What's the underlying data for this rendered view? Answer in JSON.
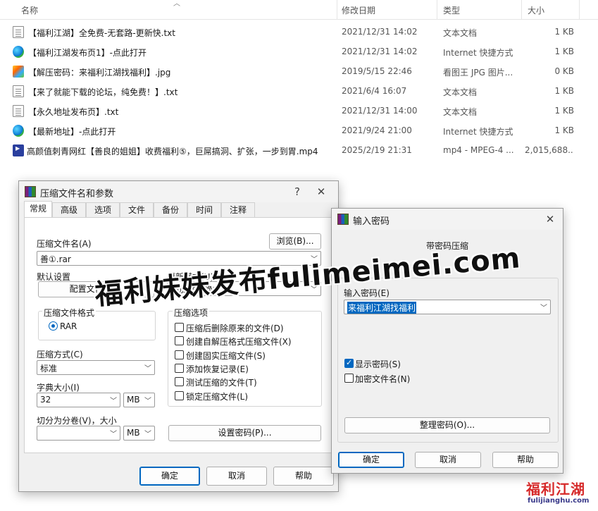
{
  "explorer": {
    "columns": {
      "name": "名称",
      "date": "修改日期",
      "type": "类型",
      "size": "大小"
    },
    "files": [
      {
        "icon": "text-file-icon",
        "name": "【福利江湖】全免费-无套路-更新快.txt",
        "date": "2021/12/31 14:02",
        "type": "文本文档",
        "size": "1 KB"
      },
      {
        "icon": "internet-shortcut-icon",
        "name": "【福利江湖发布页1】-点此打开",
        "date": "2021/12/31 14:02",
        "type": "Internet 快捷方式",
        "size": "1 KB"
      },
      {
        "icon": "jpg-image-icon",
        "name": "【解压密码：来福利江湖找福利】.jpg",
        "date": "2019/5/15 22:46",
        "type": "看图王 JPG 图片...",
        "size": "0 KB"
      },
      {
        "icon": "text-file-icon",
        "name": "【来了就能下载的论坛，纯免费！】.txt",
        "date": "2021/6/4 16:07",
        "type": "文本文档",
        "size": "1 KB"
      },
      {
        "icon": "text-file-icon",
        "name": "【永久地址发布页】.txt",
        "date": "2021/12/31 14:00",
        "type": "文本文档",
        "size": "1 KB"
      },
      {
        "icon": "internet-shortcut-icon",
        "name": "【最新地址】-点此打开",
        "date": "2021/9/24 21:00",
        "type": "Internet 快捷方式",
        "size": "1 KB"
      },
      {
        "icon": "mp4-video-icon",
        "name": "高颜值刺青网红【善良的姐姐】收费福利⑤，巨屌搞洞、扩张，一步到胃.mp4",
        "date": "2025/2/19 21:31",
        "type": "mp4 - MPEG-4 ...",
        "size": "2,015,688..."
      }
    ]
  },
  "archive_dialog": {
    "title": "压缩文件名和参数",
    "help_btn": "?",
    "close_btn": "✕",
    "tabs": [
      "常规",
      "高级",
      "选项",
      "文件",
      "备份",
      "时间",
      "注释"
    ],
    "archive_name_label": "压缩文件名(A)",
    "browse_btn": "浏览(B)...",
    "archive_name_value": "善①.rar",
    "default_profile_label": "默认设置",
    "profiles_btn": "配置文件(F)...",
    "update_mode_label": "更新模式(U)",
    "update_mode_value": "添加并替换文件",
    "format_group_label": "压缩文件格式",
    "format_rar": "RAR",
    "options_group_label": "压缩选项",
    "options": [
      {
        "label": "压缩后删除原来的文件(D)",
        "checked": false
      },
      {
        "label": "创建自解压格式压缩文件(X)",
        "checked": false
      },
      {
        "label": "创建固实压缩文件(S)",
        "checked": false
      },
      {
        "label": "添加恢复记录(E)",
        "checked": false
      },
      {
        "label": "测试压缩的文件(T)",
        "checked": false
      },
      {
        "label": "锁定压缩文件(L)",
        "checked": false
      }
    ],
    "method_label": "压缩方式(C)",
    "method_value": "标准",
    "dict_label": "字典大小(I)",
    "dict_value": "32",
    "dict_unit": "MB",
    "split_label": "切分为分卷(V)，大小",
    "split_value": "",
    "split_unit": "MB",
    "set_password_btn": "设置密码(P)...",
    "ok_btn": "确定",
    "cancel_btn": "取消",
    "help_footer_btn": "帮助"
  },
  "password_dialog": {
    "title": "输入密码",
    "close_btn": "✕",
    "heading": "带密码压缩",
    "enter_password_label": "输入密码(E)",
    "password_value": "来福利江湖找福利",
    "show_password": "显示密码(S)",
    "encrypt_filenames": "加密文件名(N)",
    "organize_btn": "整理密码(O)...",
    "ok_btn": "确定",
    "cancel_btn": "取消",
    "help_btn": "帮助"
  },
  "watermark": {
    "text": "福利妹妹发布fulimeimei.com",
    "logo_main": "福利江湖",
    "logo_url": "fulijianghu.com"
  }
}
